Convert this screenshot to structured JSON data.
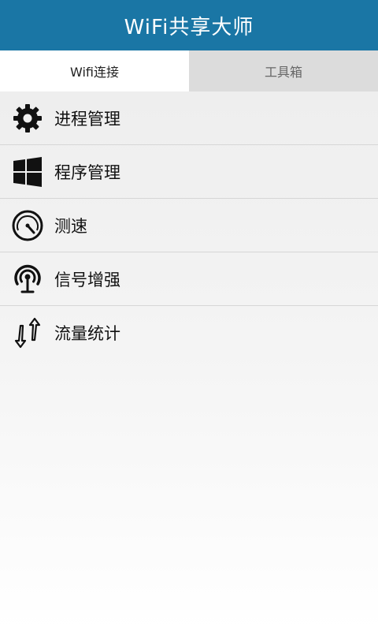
{
  "header": {
    "title": "WiFi共享大师"
  },
  "tabs": [
    {
      "label": "Wifi连接",
      "active": true
    },
    {
      "label": "工具箱",
      "active": false
    }
  ],
  "menu": {
    "items": [
      {
        "label": "进程管理",
        "icon": "gear-icon"
      },
      {
        "label": "程序管理",
        "icon": "windows-icon"
      },
      {
        "label": "测速",
        "icon": "speedometer-icon"
      },
      {
        "label": "信号增强",
        "icon": "signal-antenna-icon"
      },
      {
        "label": "流量统计",
        "icon": "traffic-arrows-icon"
      }
    ]
  },
  "colors": {
    "header_bg": "#1a76a5",
    "tab_inactive_bg": "#dcdcdc"
  }
}
